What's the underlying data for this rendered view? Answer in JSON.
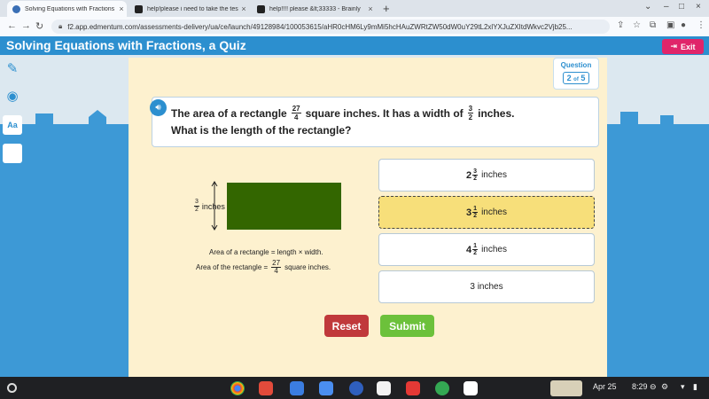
{
  "browser": {
    "tabs": [
      {
        "title": "Solving Equations with Fractions",
        "active": true
      },
      {
        "title": "help!please i need to take the tes",
        "active": false
      },
      {
        "title": "help!!!! please &lt;33333 - Brainly",
        "active": false
      }
    ],
    "url": "f2.app.edmentum.com/assessments-delivery/ua/ce/launch/49128984/100053615/aHR0cHM6Ly9mMi5hcHAuZWRtZW50dW0uY29tL2xlYXJuZXItdWkvc2Vjb25..."
  },
  "header": {
    "title": "Solving Equations with Fractions, a Quiz",
    "exit_label": "Exit"
  },
  "question": {
    "badge_label": "Question",
    "current": "2",
    "of_label": "of",
    "total": "5",
    "text_1a": "The area of a rectangle",
    "area_num": "27",
    "area_den": "4",
    "text_1b": "square inches. It has a width of",
    "width_num": "3",
    "width_den": "2",
    "text_1c": "inches.",
    "text_2": "What is the length of the rectangle?"
  },
  "figure": {
    "side_num": "3",
    "side_den": "2",
    "side_unit": "inches",
    "formula_1": "Area of a rectangle = length × width.",
    "formula_2a": "Area of the rectangle =",
    "formula_2_num": "27",
    "formula_2_den": "4",
    "formula_2b": "square inches."
  },
  "answers": [
    {
      "whole": "2",
      "num": "3",
      "den": "2",
      "unit": "inches",
      "selected": false
    },
    {
      "whole": "3",
      "num": "1",
      "den": "2",
      "unit": "inches",
      "selected": true
    },
    {
      "whole": "4",
      "num": "1",
      "den": "2",
      "unit": "inches",
      "selected": false
    },
    {
      "text": "3 inches",
      "selected": false
    }
  ],
  "buttons": {
    "reset": "Reset",
    "submit": "Submit"
  },
  "taskbar": {
    "date": "Apr 25",
    "time": "8:29"
  },
  "colors": {
    "header_blue": "#2c8fcf",
    "card_bg": "#fdf1cf",
    "selected_answer": "#f7df7a",
    "rectangle": "#336600",
    "reset": "#c0393b",
    "submit": "#6cc13b",
    "exit": "#e0256a"
  }
}
